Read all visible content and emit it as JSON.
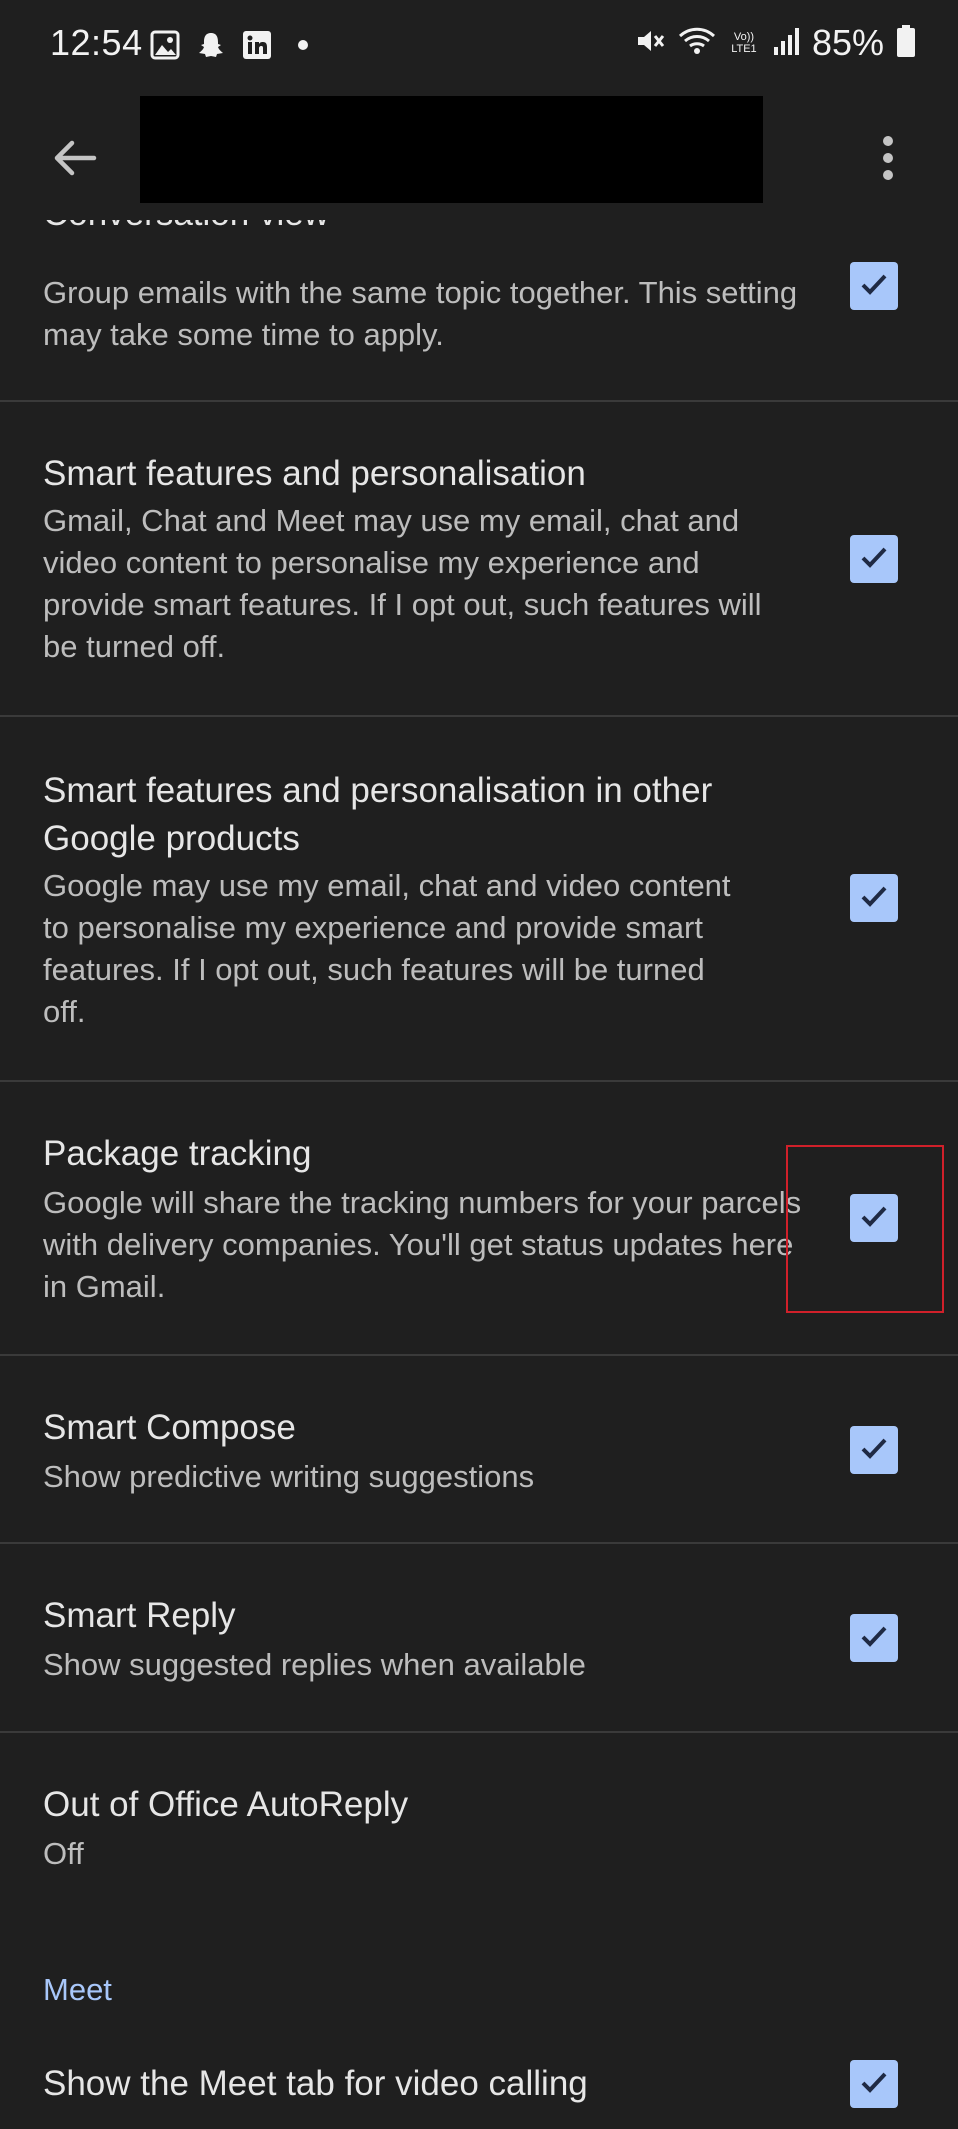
{
  "status_bar": {
    "time": "12:54",
    "battery": "85%",
    "left_icons": [
      "gallery-icon",
      "snapchat-icon",
      "linkedin-icon",
      "dot-icon"
    ],
    "right_icons": [
      "mute-icon",
      "wifi-icon",
      "volte-icon",
      "signal-icon",
      "battery-icon"
    ],
    "volte_label": "Vo)) LTE1"
  },
  "app_bar": {
    "back_icon": "arrow-left-icon",
    "more_icon": "more-vert-icon"
  },
  "settings": [
    {
      "title": "Conversation view",
      "description": "Group emails with the same topic together. This setting may take some time to apply.",
      "checked": true
    },
    {
      "title": "Smart features and personalisation",
      "description": "Gmail, Chat and Meet may use my email, chat and video content to personalise my experience and provide smart features. If I opt out, such features will be turned off.",
      "checked": true
    },
    {
      "title": "Smart features and personalisation in other Google products",
      "description": "Google may use my email, chat and video content to personalise my experience and provide smart features. If I opt out, such features will be turned off.",
      "checked": true
    },
    {
      "title": "Package tracking",
      "description": "Google will share the tracking numbers for your parcels with delivery companies. You'll get status updates here in Gmail.",
      "checked": true
    },
    {
      "title": "Smart Compose",
      "description": "Show predictive writing suggestions",
      "checked": true
    },
    {
      "title": "Smart Reply",
      "description": "Show suggested replies when available",
      "checked": true
    },
    {
      "title": "Out of Office AutoReply",
      "description": "Off"
    }
  ],
  "meet_section": {
    "header": "Meet",
    "item": {
      "title": "Show the Meet tab for video calling",
      "checked": true
    }
  },
  "colors": {
    "background": "#1f1f1f",
    "checkbox": "#a8c7fa",
    "accent": "#a8c7fa",
    "highlight": "#d0202a",
    "divider": "#3a3a3a"
  }
}
